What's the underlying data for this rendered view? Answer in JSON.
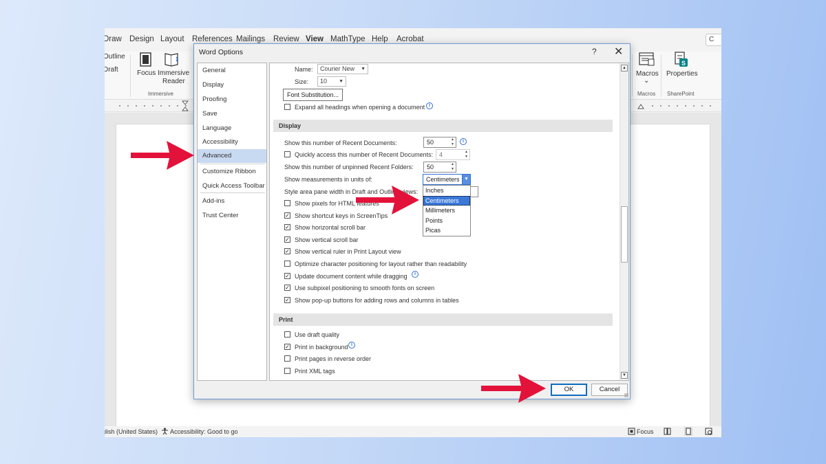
{
  "menubar": {
    "tabs": [
      "Draw",
      "Design",
      "Layout",
      "References",
      "Mailings",
      "Review",
      "View",
      "MathType",
      "Help",
      "Acrobat"
    ],
    "active_tab": "View",
    "comment_label": "C"
  },
  "ribbon": {
    "views_outline": "Outline",
    "views_draft": "Draft",
    "focus_label": "Focus",
    "immersive_reader_line1": "Immersive",
    "immersive_reader_line2": "Reader",
    "group_immersive": "Immersive",
    "macros_label": "Macros",
    "macros_dropdown": "⌄",
    "group_macros": "Macros",
    "properties_label": "Properties",
    "group_sharepoint": "SharePoint"
  },
  "statusbar": {
    "language": "glish (United States)",
    "accessibility": "Accessibility: Good to go",
    "focus": "Focus"
  },
  "dialog": {
    "title": "Word Options",
    "help": "?",
    "close": "✕",
    "nav": [
      {
        "label": "General"
      },
      {
        "label": "Display"
      },
      {
        "label": "Proofing"
      },
      {
        "label": "Save"
      },
      {
        "label": "Language"
      },
      {
        "label": "Accessibility"
      },
      {
        "label": "Advanced"
      },
      {
        "label": "Customize Ribbon"
      },
      {
        "label": "Quick Access Toolbar"
      },
      {
        "label": "Add-ins"
      },
      {
        "label": "Trust Center"
      }
    ],
    "selected_nav": "Advanced",
    "font_name_label": "Name:",
    "font_name_value": "Courier New",
    "font_size_label": "Size:",
    "font_size_value": "10",
    "font_substitution_button": "Font Substitution...",
    "expand_headings": {
      "label": "Expand all headings when opening a document",
      "checked": false
    },
    "display_section": "Display",
    "recent_docs_label": "Show this number of Recent Documents:",
    "recent_docs_value": "50",
    "quick_access_label": "Quickly access this number of Recent Documents:",
    "quick_access_value": "4",
    "recent_folders_label": "Show this number of unpinned Recent Folders:",
    "recent_folders_value": "50",
    "measurements_label": "Show measurements in units of:",
    "measurements_value": "Centimeters",
    "units_options": [
      "Inches",
      "Centimeters",
      "Millimeters",
      "Points",
      "Picas"
    ],
    "units_selected": "Centimeters",
    "style_area_label": "Style area pane width in Draft and Outline views:",
    "display_options": [
      {
        "label": "Show pixels for HTML features",
        "checked": false
      },
      {
        "label": "Show shortcut keys in ScreenTips",
        "checked": true
      },
      {
        "label": "Show horizontal scroll bar",
        "checked": true
      },
      {
        "label": "Show vertical scroll bar",
        "checked": true
      },
      {
        "label": "Show vertical ruler in Print Layout view",
        "checked": true
      },
      {
        "label": "Optimize character positioning for layout rather than readability",
        "checked": false
      },
      {
        "label": "Update document content while dragging",
        "checked": true
      },
      {
        "label": "Use subpixel positioning to smooth fonts on screen",
        "checked": true
      },
      {
        "label": "Show pop-up buttons for adding rows and columns in tables",
        "checked": true
      }
    ],
    "print_section": "Print",
    "print_options": [
      {
        "label": "Use draft quality",
        "checked": false
      },
      {
        "label": "Print in background",
        "checked": true
      },
      {
        "label": "Print pages in reverse order",
        "checked": false
      },
      {
        "label": "Print XML tags",
        "checked": false
      }
    ],
    "ok_button": "OK",
    "cancel_button": "Cancel"
  },
  "icons": {
    "info": "i",
    "check": "✓",
    "dropdown": "▼",
    "spin_up": "▲",
    "spin_down": "▼"
  },
  "colors": {
    "annotation_arrow": "#e3123a",
    "nav_selected": "#c8d9f2",
    "list_highlight": "#3b78d8",
    "info_blue": "#2f6fd6"
  }
}
